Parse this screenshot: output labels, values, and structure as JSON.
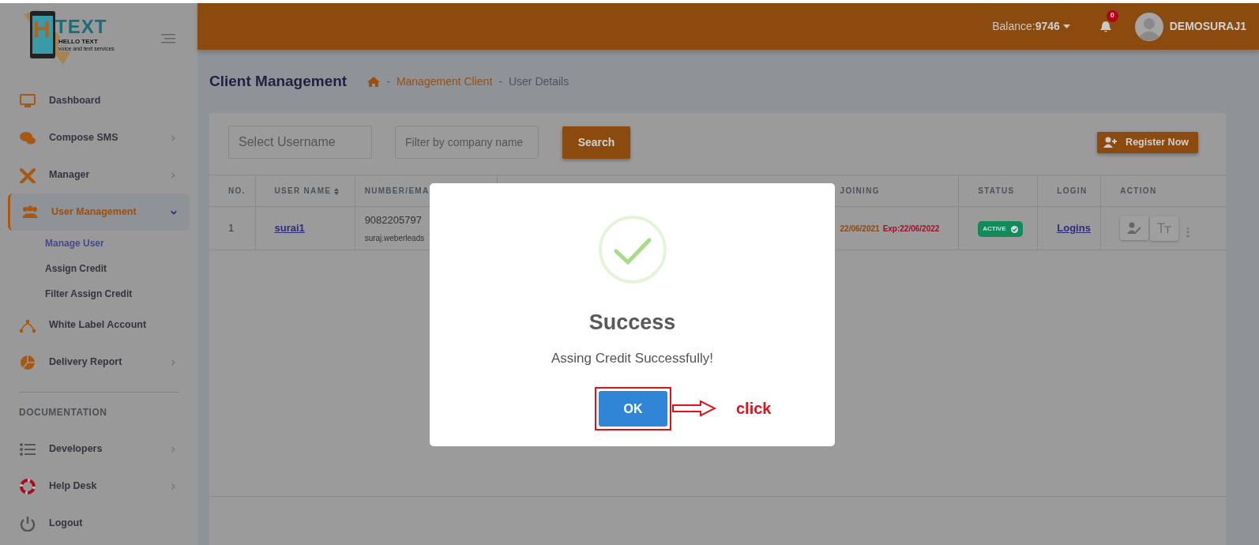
{
  "sidebar": {
    "logo": {
      "letter": "H",
      "word": "TEXT",
      "tagline": "HELLO TEXT",
      "subtitle": "voice and text services"
    },
    "items": [
      {
        "kind": "link",
        "label": "Dashboard",
        "selected": false
      },
      {
        "kind": "group",
        "label": "Compose SMS",
        "expanded": false,
        "selected": false
      },
      {
        "kind": "group",
        "label": "Manager",
        "expanded": false,
        "selected": false
      },
      {
        "kind": "group",
        "label": "User Management",
        "expanded": true,
        "selected": true,
        "children": [
          {
            "label": "Manage User",
            "selected": true
          },
          {
            "label": "Assign Credit",
            "selected": false
          },
          {
            "label": "Filter Assign Credit",
            "selected": false
          }
        ]
      },
      {
        "kind": "link",
        "label": "White Label Account",
        "selected": false
      },
      {
        "kind": "group",
        "label": "Delivery Report",
        "expanded": false,
        "selected": false
      },
      {
        "kind": "section",
        "label": "DOCUMENTATION"
      },
      {
        "kind": "group",
        "label": "Developers",
        "expanded": false,
        "selected": false
      },
      {
        "kind": "group",
        "label": "Help Desk",
        "expanded": false,
        "selected": false
      },
      {
        "kind": "link",
        "label": "Logout",
        "selected": false
      }
    ]
  },
  "topbar": {
    "balance_label": "Balance:",
    "balance": "9746",
    "notifications": "0",
    "username": "DEMOSURAJ1"
  },
  "page_title": "Client Management",
  "breadcrumb": {
    "separator": "-",
    "items": [
      "Management Client",
      "User Details"
    ]
  },
  "filters": {
    "username": {
      "placeholder": "Select Username"
    },
    "company": {
      "placeholder": "Filter by company name"
    },
    "search_button": "Search",
    "register_button": "Register Now"
  },
  "table": {
    "columns": [
      {
        "label": "NO."
      },
      {
        "label": "USER NAME",
        "sortable": true
      },
      {
        "label": "NUMBER/EMA"
      },
      {
        "label": "JOINING"
      },
      {
        "label": "STATUS"
      },
      {
        "label": "LOGIN"
      },
      {
        "label": "ACTION"
      }
    ],
    "rows": [
      {
        "no": "1",
        "username": "surai1",
        "number": "9082205797",
        "email": "suraj.weberleads",
        "joined": "22/06/2021",
        "expiry": "Exp:22/06/2022",
        "status": "ACTIVE",
        "login": "Logins"
      }
    ]
  },
  "modal": {
    "title": "Success",
    "message": "Assing Credit Successfully!",
    "ok_button": "OK",
    "annotation": "click"
  }
}
